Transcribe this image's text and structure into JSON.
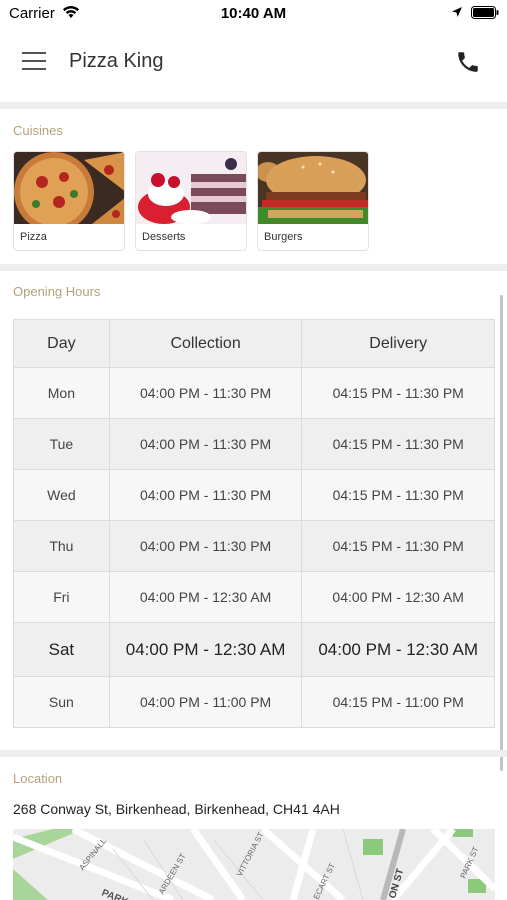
{
  "status_bar": {
    "carrier": "Carrier",
    "time": "10:40 AM"
  },
  "header": {
    "title": "Pizza King",
    "menu_icon": "hamburger-menu-icon",
    "phone_icon": "phone-icon"
  },
  "cuisines": {
    "title": "Cuisines",
    "items": [
      {
        "label": "Pizza"
      },
      {
        "label": "Desserts"
      },
      {
        "label": "Burgers"
      }
    ]
  },
  "opening_hours": {
    "title": "Opening Hours",
    "headers": {
      "day": "Day",
      "collection": "Collection",
      "delivery": "Delivery"
    },
    "rows": [
      {
        "day": "Mon",
        "collection": "04:00 PM - 11:30 PM",
        "delivery": "04:15 PM - 11:30 PM"
      },
      {
        "day": "Tue",
        "collection": "04:00 PM - 11:30 PM",
        "delivery": "04:15 PM - 11:30 PM"
      },
      {
        "day": "Wed",
        "collection": "04:00 PM - 11:30 PM",
        "delivery": "04:15 PM - 11:30 PM"
      },
      {
        "day": "Thu",
        "collection": "04:00 PM - 11:30 PM",
        "delivery": "04:15 PM - 11:30 PM"
      },
      {
        "day": "Fri",
        "collection": "04:00 PM - 12:30 AM",
        "delivery": "04:00 PM - 12:30 AM"
      },
      {
        "day": "Sat",
        "collection": "04:00 PM - 12:30 AM",
        "delivery": "04:00 PM - 12:30 AM"
      },
      {
        "day": "Sun",
        "collection": "04:00 PM - 11:00 PM",
        "delivery": "04:15 PM - 11:00 PM"
      }
    ]
  },
  "location": {
    "title": "Location",
    "address": "268 Conway St, Birkenhead, Birkenhead, CH41 4AH",
    "map_labels": {
      "aspinall": "ASPINALL",
      "park": "PARK",
      "ardeen": "ARDEEN ST",
      "vittoria": "VITTORIA ST",
      "ecart": "ECART ST",
      "on_st": "ON ST",
      "park_st": "PARK ST"
    }
  }
}
